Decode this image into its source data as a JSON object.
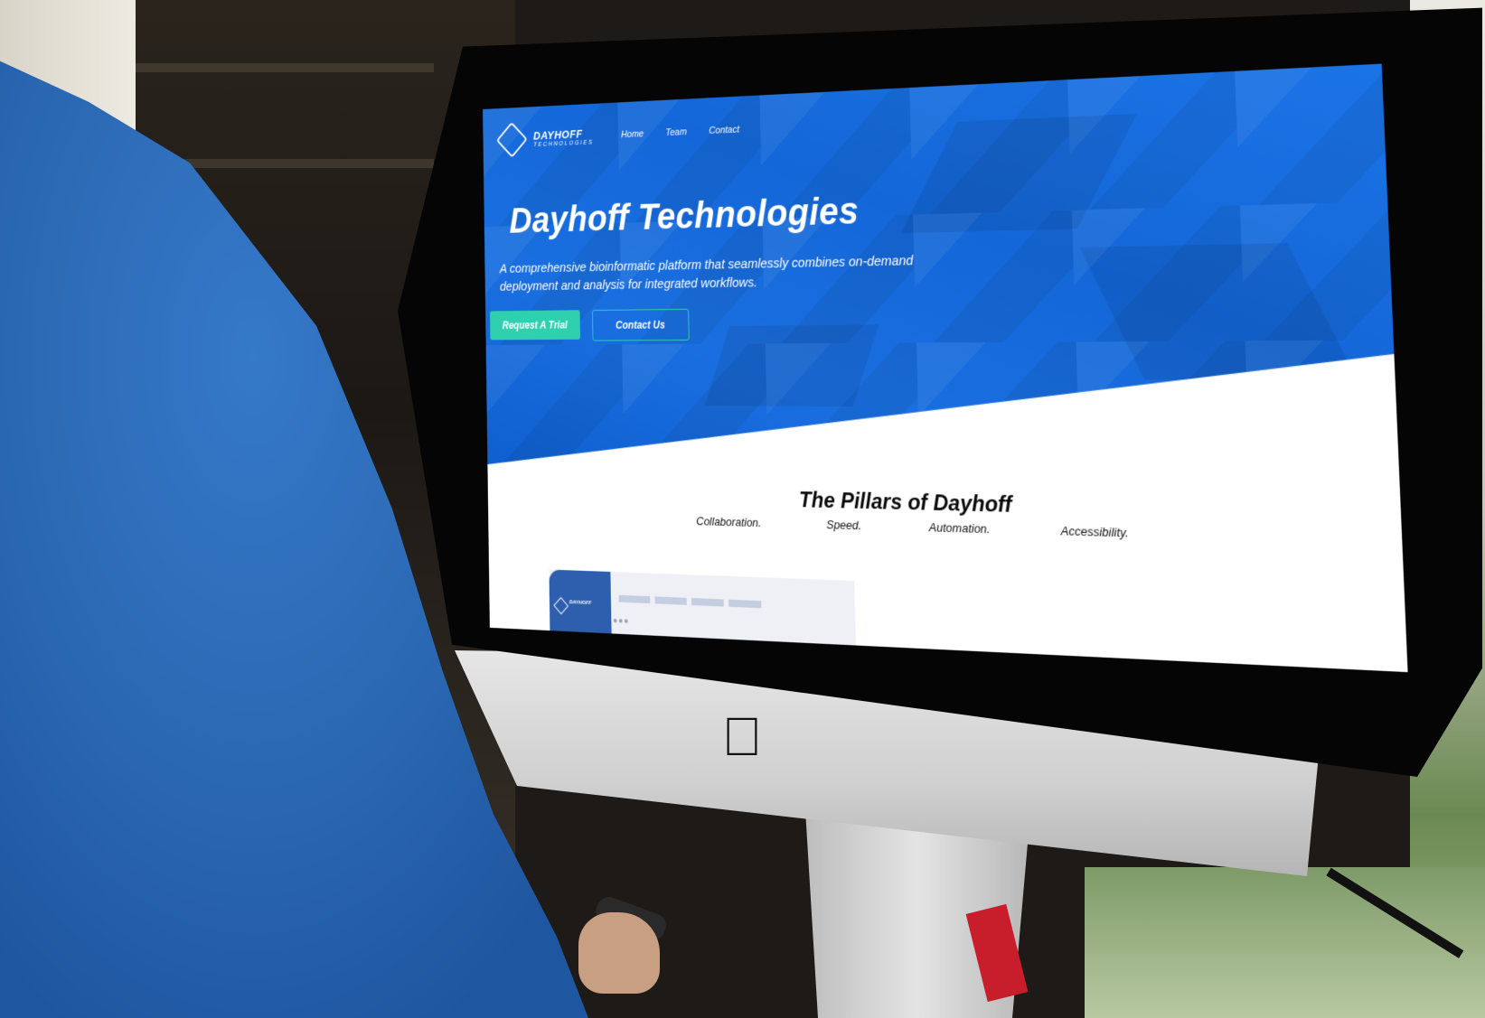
{
  "site": {
    "logo_title": "DAYHOFF",
    "logo_subtitle": "TECHNOLOGIES",
    "nav": [
      {
        "label": "Home"
      },
      {
        "label": "Team"
      },
      {
        "label": "Contact"
      }
    ]
  },
  "hero": {
    "title": "Dayhoff Technologies",
    "subtitle": "A comprehensive bioinformatic platform that seamlessly combines on-demand deployment and analysis for integrated workflows.",
    "primary_button": "Request A Trial",
    "secondary_button": "Contact Us"
  },
  "pillars": {
    "title": "The Pillars of Dayhoff",
    "items": [
      "Collaboration.",
      "Speed.",
      "Automation.",
      "Accessibility."
    ]
  },
  "preview": {
    "logo_text": "DAYHOFF"
  },
  "colors": {
    "hero_blue": "#1b74e6",
    "accent_teal": "#2fd0b0",
    "sweater_blue": "#2b68b3"
  },
  "icons": [
    "dayhoff-logo-icon",
    "apple-logo-icon"
  ]
}
